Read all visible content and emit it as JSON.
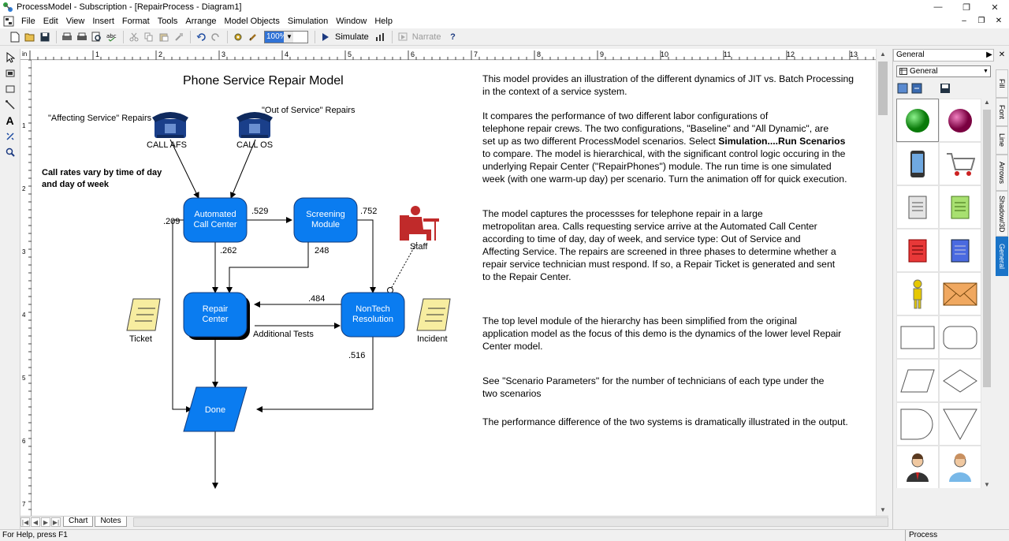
{
  "window": {
    "title": "ProcessModel - Subscription - [RepairProcess - Diagram1]",
    "controls": {
      "minimize": "—",
      "maximize": "❐",
      "close": "✕"
    }
  },
  "menu": {
    "items": [
      "File",
      "Edit",
      "View",
      "Insert",
      "Format",
      "Tools",
      "Arrange",
      "Model Objects",
      "Simulation",
      "Window",
      "Help"
    ],
    "mdi": {
      "minimize": "–",
      "restore": "❐",
      "close": "✕"
    }
  },
  "toolbar": {
    "zoom_value": "100%",
    "simulate_label": "Simulate",
    "narrate_label": "Narrate",
    "help_glyph": "?"
  },
  "ruler": {
    "unit_label": "in",
    "top_ticks": [
      "1",
      "2",
      "3",
      "4",
      "5",
      "6",
      "7",
      "8",
      "9",
      "10",
      "11",
      "12",
      "13"
    ],
    "left_ticks": [
      "1",
      "2",
      "3",
      "4",
      "5",
      "6",
      "7"
    ]
  },
  "diagram": {
    "title": "Phone Service Repair Model",
    "labels": {
      "affecting": "\"Affecting Service\" Repairs",
      "out_of_service": "\"Out of Service\" Repairs",
      "call_afs": "CALL AFS",
      "call_os": "CALL OS",
      "call_rates": "Call rates vary by time of day and day of week",
      "staff": "Staff",
      "ticket": "Ticket",
      "incident": "Incident",
      "additional_tests": "Additional Tests"
    },
    "nodes": {
      "acc": [
        "Automated",
        "Call Center"
      ],
      "screening": [
        "Screening",
        "Module"
      ],
      "repair": [
        "Repair",
        "Center"
      ],
      "nontech": [
        "NonTech",
        "Resolution"
      ],
      "done": "Done"
    },
    "probs": {
      "p209": ".209",
      "p529": ".529",
      "p752": ".752",
      "p262": ".262",
      "p248": "248",
      "p484": ".484",
      "p516": ".516"
    },
    "colors": {
      "node_fill": "#0a7cf0",
      "node_stroke": "#123a7a",
      "shadow": "#000000",
      "phone": "#1a3f8a",
      "staff": "#c02a2a",
      "note": "#f7eda0"
    }
  },
  "description": {
    "p1": "This model provides an illustration of the different dynamics of JIT vs. Batch Processing\nin the context of a service system.",
    "p2_a": "It  compares the performance of two different labor configurations of\ntelephone repair crews.  The two configurations, \"Baseline\" and \"All Dynamic\", are\nset up as two different ProcessModel scenarios.  Select ",
    "p2_bold": "Simulation....Run Scenarios",
    "p2_b": "\nto compare.  The model is hierarchical, with the significant control logic occuring in the\nunderlying Repair Center (\"RepairPhones\") module. The run time is one simulated\nweek (with one warm-up day) per scenario.  Turn the animation off for quick execution.",
    "p3": "The model captures  the processses for telephone repair in a large\nmetropolitan area.  Calls requesting service arrive at the Automated Call Center\naccording to time of day, day of week, and service type:  Out of Service and\nAffecting Service.  The repairs are screened in three phases to determine whether a\nrepair service technician must respond.  If so, a Repair Ticket is generated and sent\nto the Repair Center.",
    "p4": "The top level module of the hierarchy has been simplified from the original\napplication model as the focus of this demo is the dynamics of the lower level Repair\nCenter model.",
    "p5": "See  \"Scenario Parameters\" for the number of technicians of each type under the\n two scenarios",
    "p6": "The performance difference of the two systems is dramatically illustrated in the output."
  },
  "sheet_tabs": [
    "Chart",
    "Notes"
  ],
  "status": {
    "help": "For Help, press F1",
    "mode": "Process"
  },
  "palette": {
    "header": "General",
    "select_value": "General",
    "tabs": [
      "Fill",
      "Font",
      "Line",
      "Arrows",
      "Shadow/3D",
      "General"
    ],
    "active_tab": "General",
    "items": [
      "green-ball",
      "magenta-ball",
      "phone",
      "cart",
      "doc-gray",
      "doc-green",
      "doc-red",
      "doc-blue",
      "person-yellow",
      "envelope",
      "rectangle",
      "rounded-rect",
      "parallelogram",
      "diamond",
      "delay",
      "merge",
      "businessman",
      "person-blue"
    ]
  }
}
